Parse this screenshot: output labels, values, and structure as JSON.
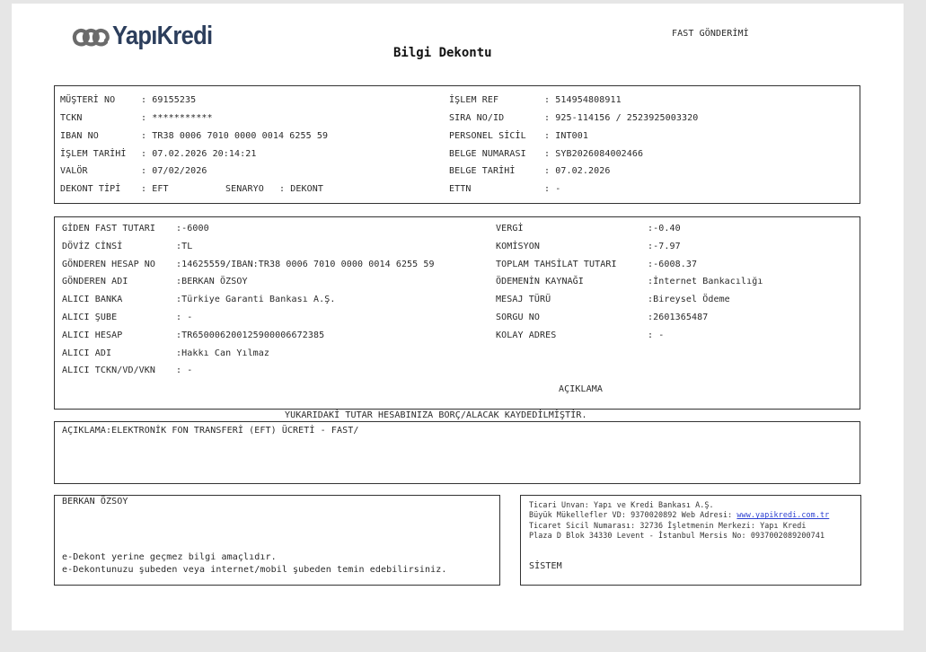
{
  "header": {
    "brand": "YapıKredi",
    "transaction_kind": "FAST GÖNDERİMİ",
    "document_title": "Bilgi Dekontu"
  },
  "info_left": [
    {
      "label": "MÜŞTERİ NO",
      "value": ": 69155235"
    },
    {
      "label": "TCKN",
      "value": ": ***********"
    },
    {
      "label": "IBAN NO",
      "value": ": TR38 0006 7010 0000 0014 6255 59"
    },
    {
      "label": "İŞLEM TARİHİ",
      "value": ": 07.02.2026 20:14:21"
    },
    {
      "label": "VALÖR",
      "value": ": 07/02/2026"
    },
    {
      "label": "DEKONT TİPİ",
      "value": ": EFT"
    }
  ],
  "scenario": {
    "label": "SENARYO",
    "value": ": DEKONT"
  },
  "info_right": [
    {
      "label": "İŞLEM REF",
      "value": ": 514954808911"
    },
    {
      "label": "SIRA NO/ID",
      "value": ": 925-114156 / 2523925003320"
    },
    {
      "label": "PERSONEL SİCİL",
      "value": ": INT001"
    },
    {
      "label": "BELGE NUMARASI",
      "value": ": SYB2026084002466"
    },
    {
      "label": "BELGE TARİHİ",
      "value": ": 07.02.2026"
    },
    {
      "label": "ETTN",
      "value": ": -"
    }
  ],
  "transfer_left": [
    {
      "label": "GİDEN FAST TUTARI",
      "value": ":-6000"
    },
    {
      "label": "DÖVİZ CİNSİ",
      "value": ":TL"
    },
    {
      "label": "GÖNDEREN HESAP NO",
      "value": ":14625559/IBAN:TR38 0006 7010 0000 0014 6255 59"
    },
    {
      "label": "GÖNDEREN ADI",
      "value": ":BERKAN ÖZSOY"
    },
    {
      "label": "ALICI BANKA",
      "value": ":Türkiye Garanti Bankası A.Ş."
    },
    {
      "label": "ALICI ŞUBE",
      "value": ": -"
    },
    {
      "label": "ALICI HESAP",
      "value": ":TR650006200125900006672385"
    },
    {
      "label": "ALICI ADI",
      "value": ":Hakkı Can Yılmaz"
    },
    {
      "label": "ALICI TCKN/VD/VKN",
      "value": ": -"
    }
  ],
  "transfer_right": [
    {
      "label": "VERGİ",
      "value": ":-0.40"
    },
    {
      "label": "KOMİSYON",
      "value": ":-7.97"
    },
    {
      "label": "TOPLAM TAHSİLAT TUTARI",
      "value": ":-6008.37"
    },
    {
      "label": "ÖDEMENİN KAYNAĞI",
      "value": ":İnternet Bankacılığı"
    },
    {
      "label": "MESAJ TÜRÜ",
      "value": ":Bireysel Ödeme"
    },
    {
      "label": "SORGU NO",
      "value": ":2601365487"
    },
    {
      "label": "KOLAY ADRES",
      "value": ": -"
    }
  ],
  "aciklama_heading": "AÇIKLAMA",
  "notice": "YUKARIDAKİ TUTAR HESABINIZA BORÇ/ALACAK KAYDEDİLMİŞTİR.",
  "description": "AÇIKLAMA:ELEKTRONİK FON TRANSFERİ (EFT) ÜCRETİ - FAST/",
  "customer_box": {
    "name": "BERKAN ÖZSOY",
    "note1": "e-Dekont yerine geçmez bilgi amaçlıdır.",
    "note2": "e-Dekontunuzu şubeden veya internet/mobil şubeden temin edebilirsiniz."
  },
  "bank_box": {
    "line1": "Ticari Unvan: Yapı ve Kredi Bankası A.Ş.",
    "line2_prefix": "Büyük Mükellefler VD: 9370020892 Web Adresi: ",
    "web": "www.yapikredi.com.tr",
    "line3": "Ticaret Sicil Numarası: 32736 İşletmenin Merkezi: Yapı Kredi",
    "line4": "Plaza D Blok 34330 Levent - İstanbul Mersis No: 0937002089200741",
    "signer": "SİSTEM"
  }
}
